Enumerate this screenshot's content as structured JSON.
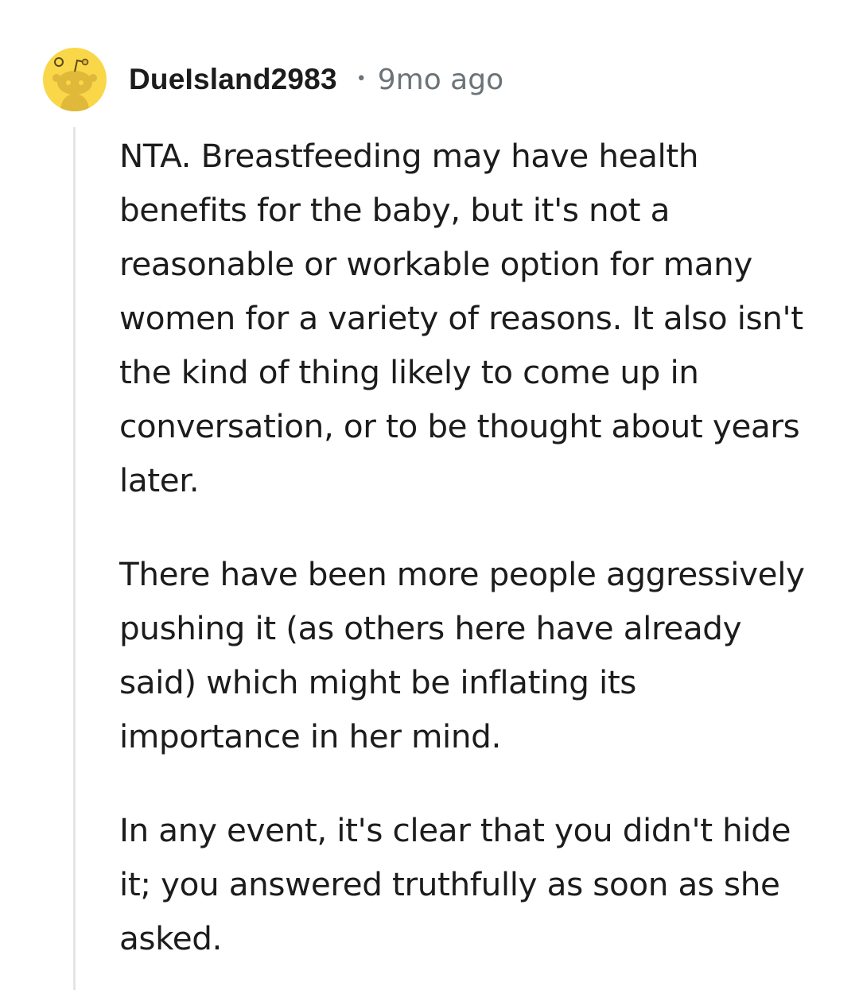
{
  "comment": {
    "author": "DueIsland2983",
    "separator": "•",
    "timestamp": "9mo ago",
    "avatar_icon": "reddit-snoo-avatar-icon",
    "avatar_color": "#f9d748",
    "paragraphs": [
      "NTA. Breastfeeding may have health benefits for the baby, but it's not a reasonable or workable option for many women for a variety of reasons. It also isn't the kind of thing likely to come up in conversation, or to be thought about years later.",
      "There have been more people aggressively pushing it (as others here have already said) which might be inflating its importance in her mind.",
      "In any event, it's clear that you didn't hide it; you answered truthfully as soon as she asked."
    ]
  }
}
